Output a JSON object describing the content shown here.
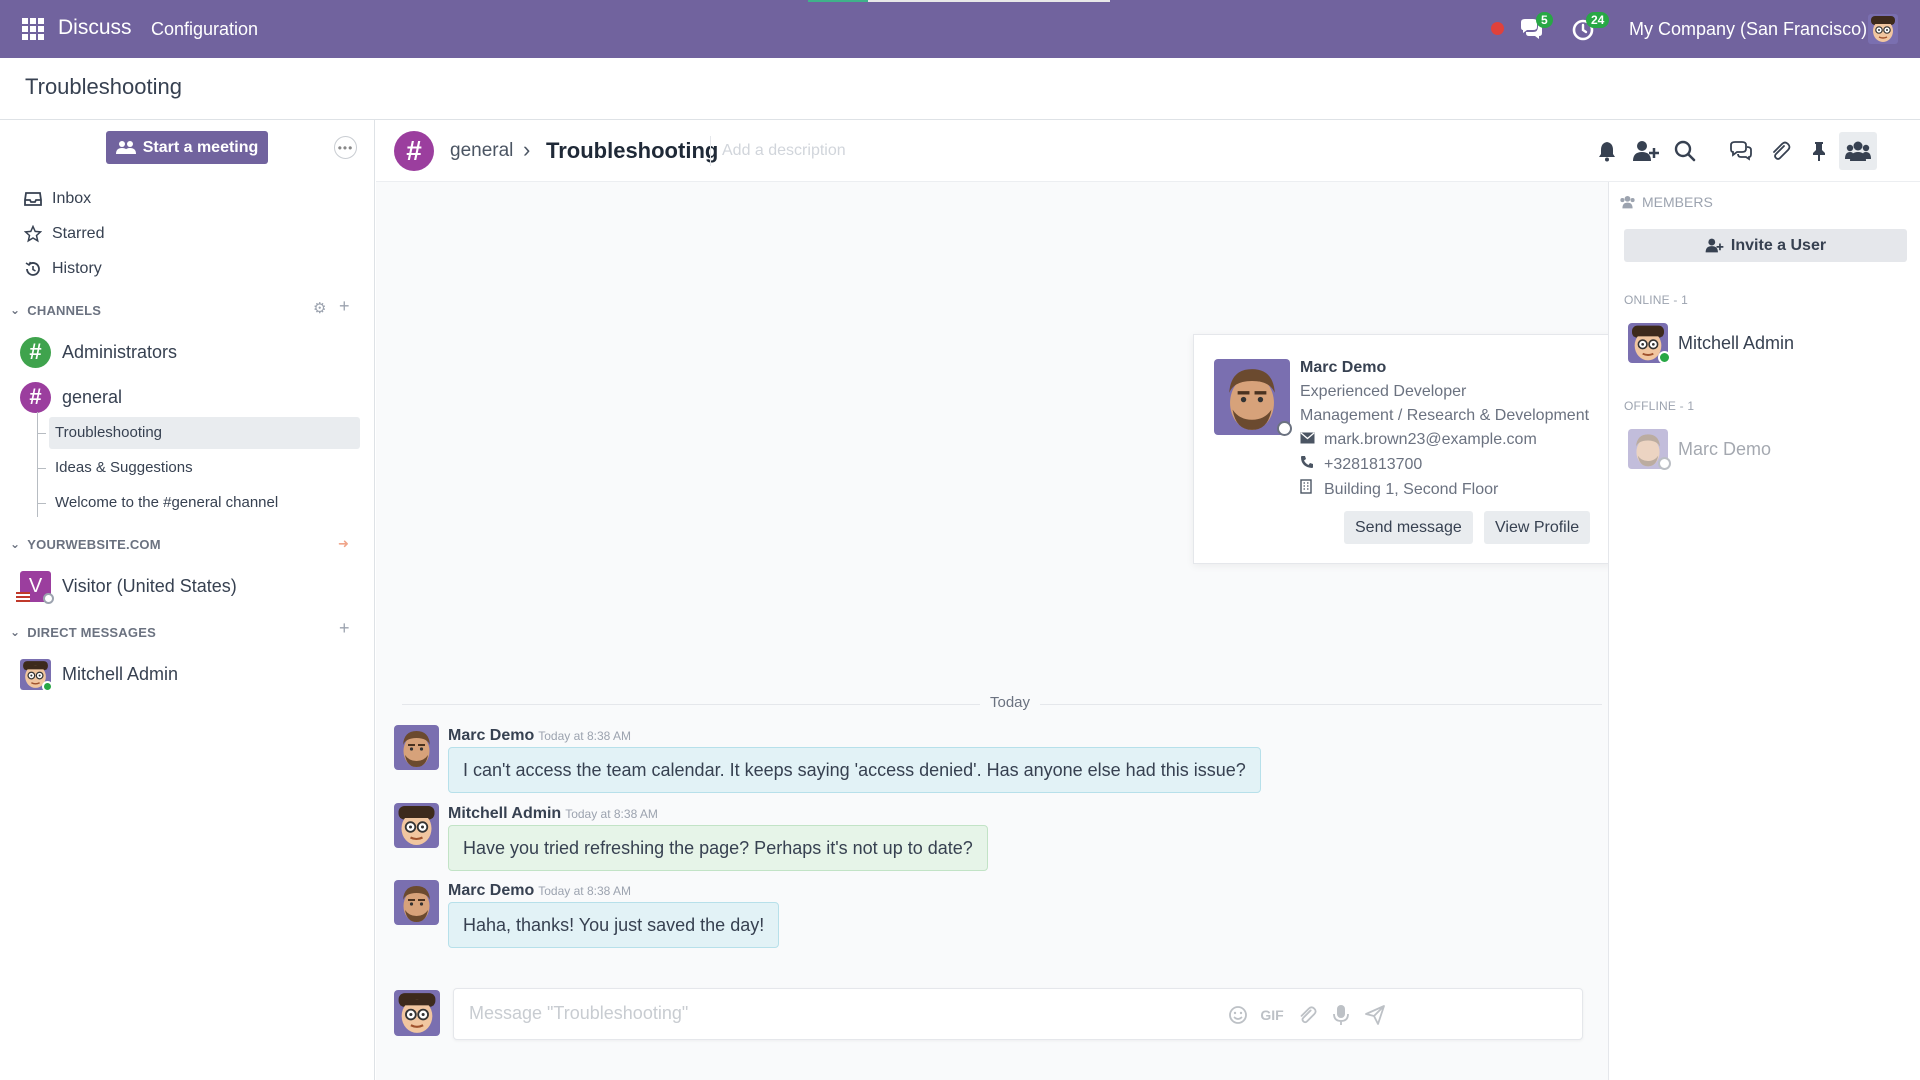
{
  "navbar": {
    "app_name": "Discuss",
    "menu_configuration": "Configuration",
    "messages_badge": "5",
    "activities_badge": "24",
    "company": "My Company (San Francisco)"
  },
  "control_panel": {
    "title": "Troubleshooting"
  },
  "sidebar": {
    "start_meeting": "Start a meeting",
    "mailboxes": [
      {
        "label": "Inbox",
        "icon": "inbox-icon"
      },
      {
        "label": "Starred",
        "icon": "star-icon"
      },
      {
        "label": "History",
        "icon": "history-icon"
      }
    ],
    "channels_header": "CHANNELS",
    "channels": [
      {
        "label": "Administrators",
        "color": "#3fa34d"
      },
      {
        "label": "general",
        "color": "#9b3e9e"
      }
    ],
    "sub_threads": [
      "Troubleshooting",
      "Ideas & Suggestions",
      "Welcome to the #general channel"
    ],
    "website_header": "YOURWEBSITE.COM",
    "visitor": {
      "initial": "V",
      "label": "Visitor (United States)"
    },
    "dm_header": "DIRECT MESSAGES",
    "dm": [
      {
        "label": "Mitchell Admin"
      }
    ]
  },
  "thread": {
    "parent": "general",
    "name": "Troubleshooting",
    "description_placeholder": "Add a description"
  },
  "chat": {
    "date_separator": "Today",
    "messages": [
      {
        "author": "Marc Demo",
        "time": "Today at 8:38 AM",
        "text": "I can't access the team calendar. It keeps saying 'access denied'. Has anyone else had this issue?"
      },
      {
        "author": "Mitchell Admin",
        "time": "Today at 8:38 AM",
        "text": "Have you tried refreshing the page? Perhaps it's not up to date?"
      },
      {
        "author": "Marc Demo",
        "time": "Today at 8:38 AM",
        "text": "Haha, thanks! You just saved the day!"
      }
    ],
    "composer_placeholder": "Message \"Troubleshooting\"",
    "gif_label": "GIF"
  },
  "profile_card": {
    "name": "Marc Demo",
    "job": "Experienced Developer",
    "department": "Management / Research & Development",
    "email": "mark.brown23@example.com",
    "phone": "+3281813700",
    "location": "Building 1, Second Floor",
    "send_message": "Send message",
    "view_profile": "View Profile"
  },
  "members": {
    "title": "MEMBERS",
    "invite": "Invite a User",
    "online_label": "ONLINE - 1",
    "offline_label": "OFFLINE - 1",
    "online": [
      "Mitchell Admin"
    ],
    "offline": [
      "Marc Demo"
    ]
  },
  "colors": {
    "brand": "#71639e",
    "online": "#28a745",
    "hash_general": "#9b3e9e",
    "hash_admin": "#3fa34d"
  }
}
